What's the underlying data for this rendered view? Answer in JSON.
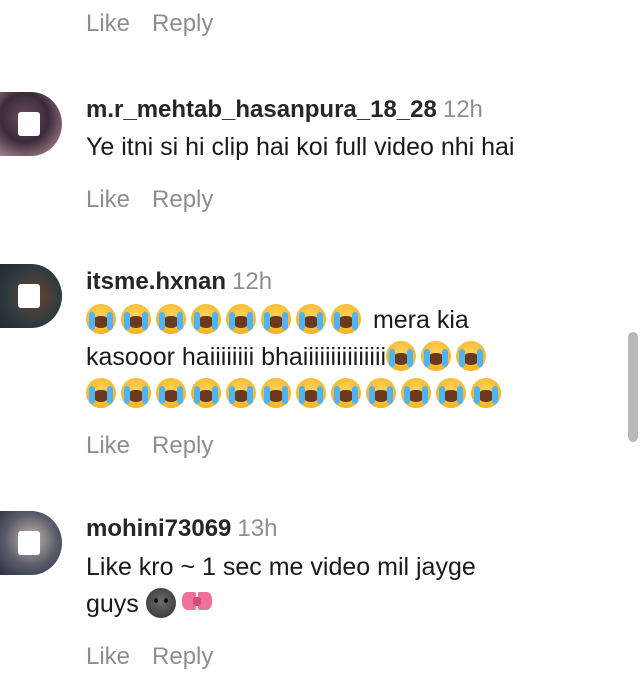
{
  "top_actions": {
    "like": "Like",
    "reply": "Reply"
  },
  "comments": [
    {
      "username": "m.r_mehtab_hasanpura_18_28",
      "time": "12h",
      "text": "Ye itni si hi clip hai koi full video nhi hai",
      "like": "Like",
      "reply": "Reply"
    },
    {
      "username": "itsme.hxnan",
      "time": "12h",
      "text_line1": "mera kia",
      "text_line2": "kasooor haiiiiiiii bhaiiiiiiiiiiiiiii",
      "emoji_name": "loudly-crying-face",
      "like": "Like",
      "reply": "Reply"
    },
    {
      "username": "mohini73069",
      "time": "13h",
      "text_line1": "Like kro ~ 1 sec me video mil jayge",
      "text_line2": "guys",
      "like": "Like",
      "reply": "Reply"
    }
  ],
  "colors": {
    "meta_gray": "#8e8e8e",
    "text": "#1a1a1a",
    "scrollbar": "#b9b9b9"
  }
}
